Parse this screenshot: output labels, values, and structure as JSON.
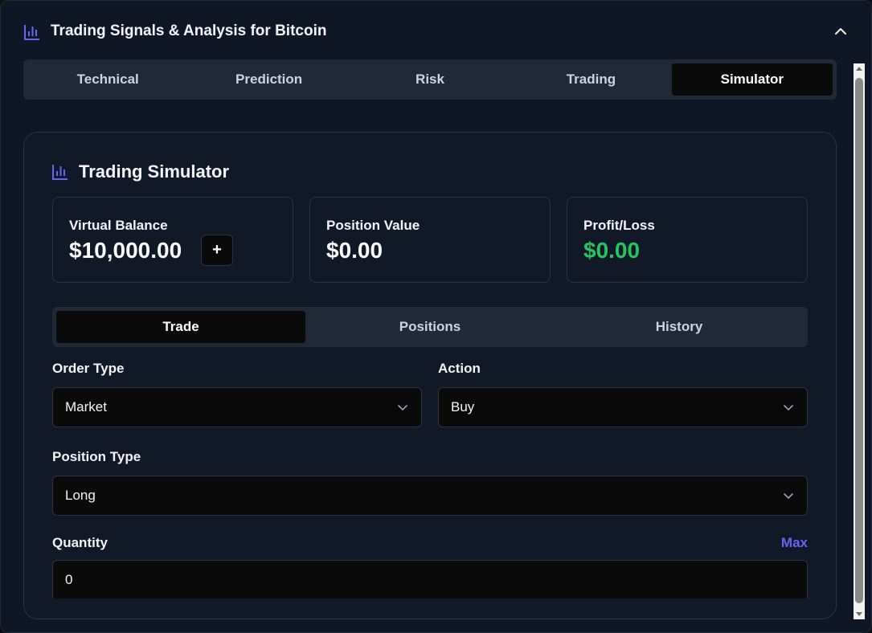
{
  "header": {
    "title": "Trading Signals & Analysis for Bitcoin",
    "icon": "bar-chart-icon"
  },
  "tabs": [
    {
      "label": "Technical",
      "active": false
    },
    {
      "label": "Prediction",
      "active": false
    },
    {
      "label": "Risk",
      "active": false
    },
    {
      "label": "Trading",
      "active": false
    },
    {
      "label": "Simulator",
      "active": true
    }
  ],
  "simulator": {
    "title": "Trading Simulator",
    "stats": {
      "balance": {
        "label": "Virtual Balance",
        "value": "$10,000.00",
        "add_label": "+"
      },
      "position": {
        "label": "Position Value",
        "value": "$0.00"
      },
      "pnl": {
        "label": "Profit/Loss",
        "value": "$0.00"
      }
    },
    "subtabs": [
      {
        "label": "Trade",
        "active": true
      },
      {
        "label": "Positions",
        "active": false
      },
      {
        "label": "History",
        "active": false
      }
    ],
    "form": {
      "order_type": {
        "label": "Order Type",
        "value": "Market"
      },
      "action": {
        "label": "Action",
        "value": "Buy"
      },
      "position_type": {
        "label": "Position Type",
        "value": "Long"
      },
      "quantity": {
        "label": "Quantity",
        "value": "0",
        "max_label": "Max"
      }
    }
  },
  "colors": {
    "accent": "#6366f1",
    "profit": "#22c55e",
    "panel": "#111827",
    "background": "#0f1626"
  }
}
